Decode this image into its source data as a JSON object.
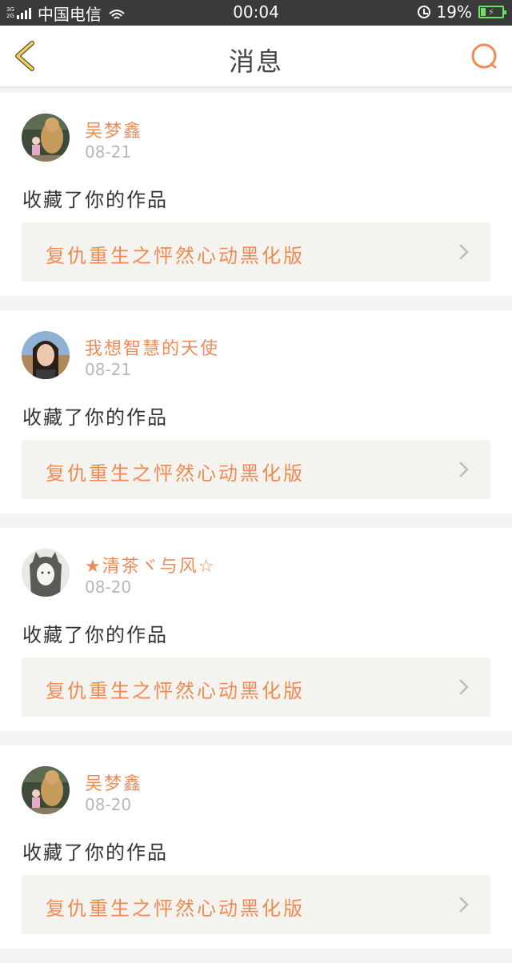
{
  "status_bar": {
    "network_top": "3G",
    "network_bottom": "2G",
    "carrier": "中国电信",
    "time": "00:04",
    "battery": "19%"
  },
  "header": {
    "title": "消息",
    "back_icon": "chevron-left-icon",
    "search_icon": "search-icon"
  },
  "colors": {
    "accent": "#f08a55",
    "back_arrow": "#f5d04a",
    "card_bg": "#ffffff",
    "work_bg": "#f3f3ef",
    "date": "#b8b8b8"
  },
  "messages": [
    {
      "user": "吴梦鑫",
      "date": "08-21",
      "action": "收藏了你的作品",
      "work": "复仇重生之怦然心动黑化版",
      "avatar": "avatar-bear"
    },
    {
      "user": "我想智慧的天使",
      "date": "08-21",
      "action": "收藏了你的作品",
      "work": "复仇重生之怦然心动黑化版",
      "avatar": "avatar-girl"
    },
    {
      "user": "★清茶ヾ与风☆",
      "date": "08-20",
      "action": "收藏了你的作品",
      "work": "复仇重生之怦然心动黑化版",
      "avatar": "avatar-sketch"
    },
    {
      "user": "吴梦鑫",
      "date": "08-20",
      "action": "收藏了你的作品",
      "work": "复仇重生之怦然心动黑化版",
      "avatar": "avatar-bear"
    }
  ]
}
